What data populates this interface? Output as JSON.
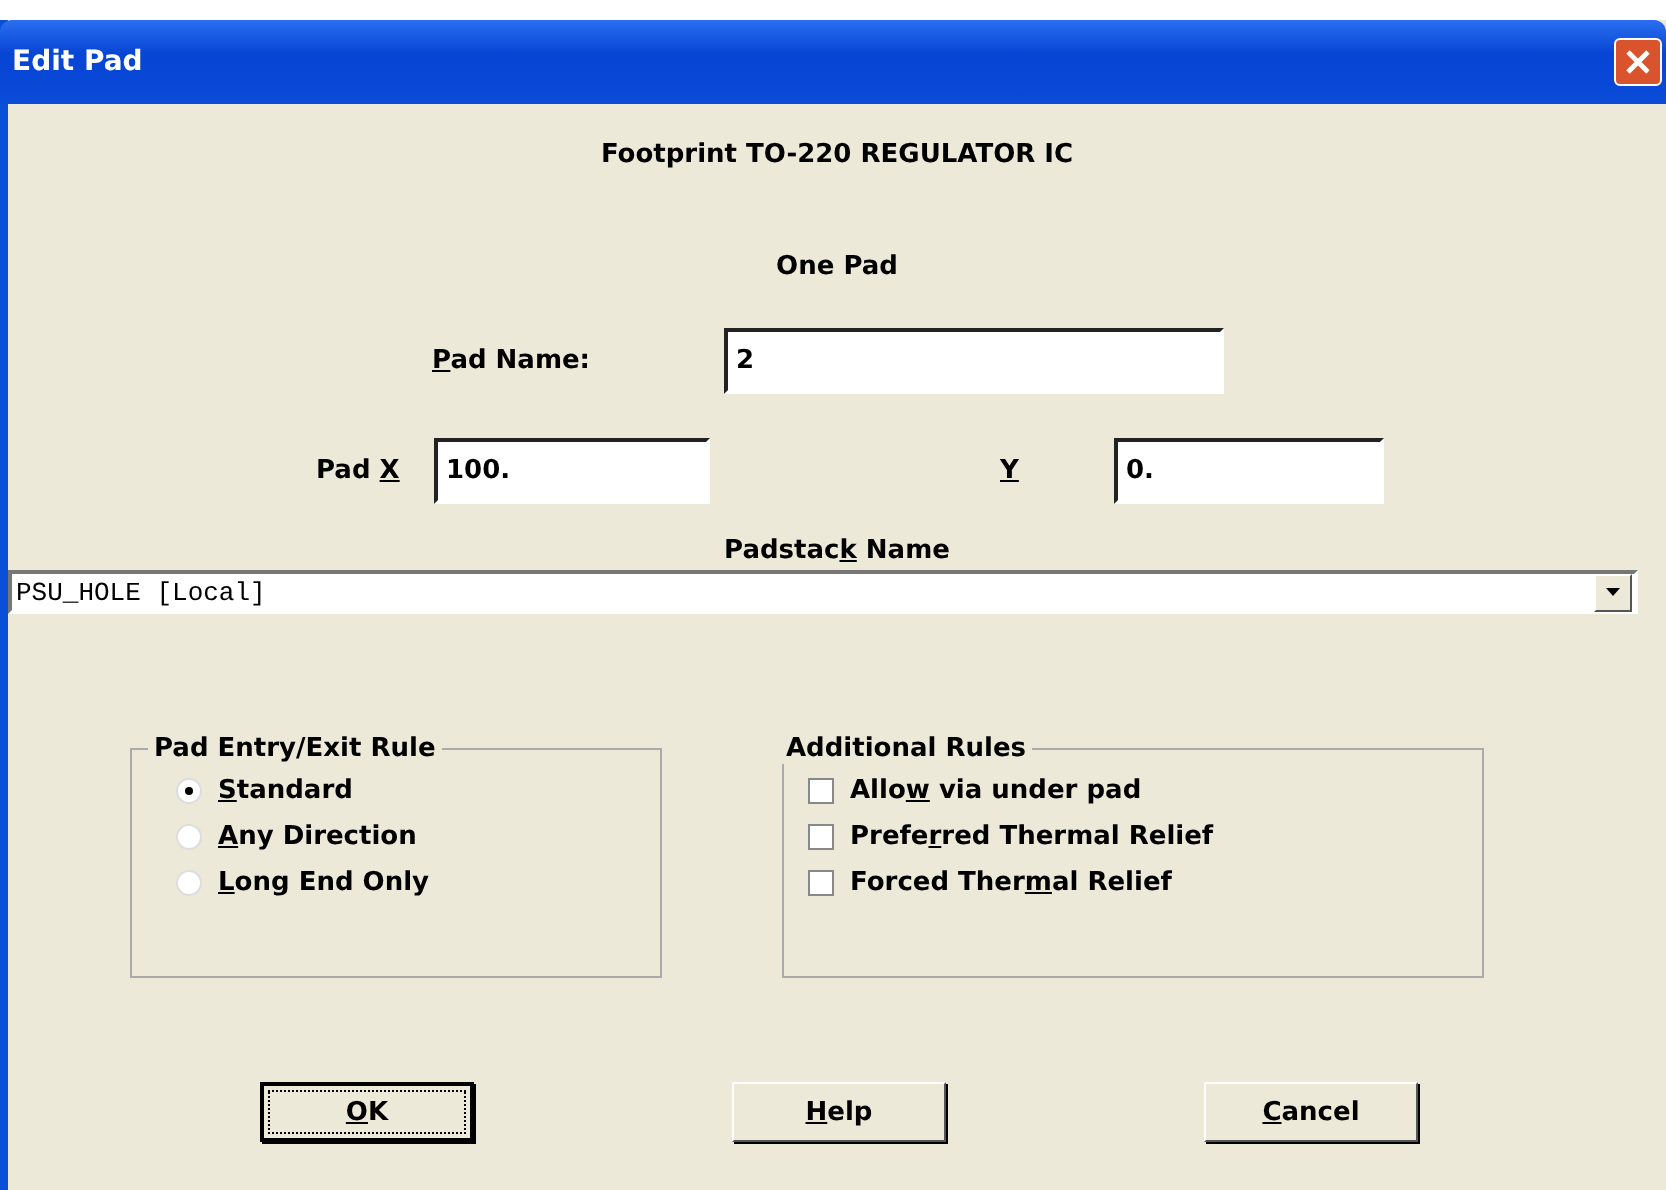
{
  "window": {
    "title": "Edit Pad"
  },
  "heading": "Footprint TO-220 REGULATOR IC",
  "subheading": "One Pad",
  "pad_name": {
    "label": {
      "key": "P",
      "post": "ad Name:"
    },
    "value": "2"
  },
  "pad_x": {
    "label": {
      "pre": "Pad ",
      "key": "X"
    },
    "value": "100."
  },
  "pad_y": {
    "label": {
      "key": "Y"
    },
    "value": "0."
  },
  "padstack": {
    "label": {
      "pre": "Padstac",
      "key": "k",
      "post": " Name"
    },
    "value": "PSU_HOLE [Local]"
  },
  "entry_rule": {
    "title": "Pad Entry/Exit Rule",
    "options": [
      {
        "label": {
          "key": "S",
          "post": "tandard"
        },
        "selected": true
      },
      {
        "label": {
          "key": "A",
          "post": "ny Direction"
        },
        "selected": false
      },
      {
        "label": {
          "key": "L",
          "post": "ong End Only"
        },
        "selected": false
      }
    ]
  },
  "additional_rules": {
    "title": "Additional Rules",
    "options": [
      {
        "label": {
          "pre": "Allo",
          "key": "w",
          "post": " via under pad"
        },
        "checked": false
      },
      {
        "label": {
          "pre": "Prefe",
          "key": "r",
          "post": "red Thermal Relief"
        },
        "checked": false
      },
      {
        "label": {
          "pre": "Forced Ther",
          "key": "m",
          "post": "al Relief"
        },
        "checked": false
      }
    ]
  },
  "buttons": [
    {
      "label": {
        "key": "O",
        "post": "K"
      },
      "default": true
    },
    {
      "label": {
        "key": "H",
        "post": "elp"
      },
      "default": false
    },
    {
      "label": {
        "key": "C",
        "post": "ancel"
      },
      "default": false
    }
  ]
}
